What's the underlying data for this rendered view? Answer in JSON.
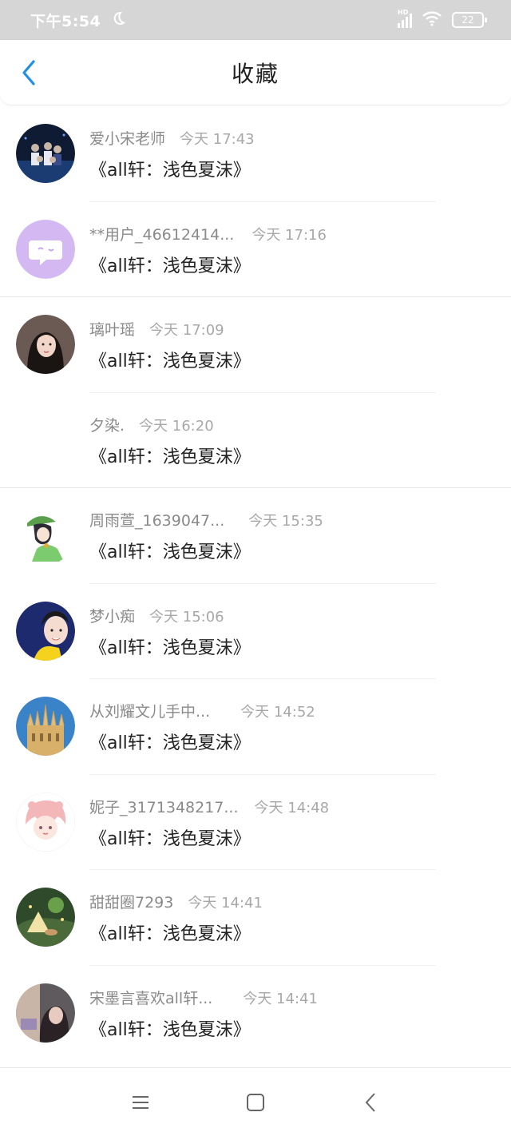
{
  "status_bar": {
    "time": "下午5:54",
    "battery": "22",
    "network": "HD"
  },
  "header": {
    "title": "收藏",
    "back_icon": "chevron-left-icon",
    "accent_color": "#1e90e6"
  },
  "items": [
    {
      "user": "爱小宋老师",
      "time": "今天 17:43",
      "title": "《all轩：浅色夏沫》",
      "avatar": "photo-group-concert"
    },
    {
      "user": "**用户_46612414...",
      "time": "今天 17:16",
      "title": "《all轩：浅色夏沫》",
      "avatar": "default-chat-bubble"
    },
    {
      "user": "璃叶瑶",
      "time": "今天 17:09",
      "title": "《all轩：浅色夏沫》",
      "avatar": "photo-portrait-girl"
    },
    {
      "user": "夕染.",
      "time": "今天 16:20",
      "title": "《all轩：浅色夏沫》",
      "avatar": "none"
    },
    {
      "user": "周雨萱_1639047...",
      "time": "今天 15:35",
      "title": "《all轩：浅色夏沫》",
      "avatar": "anime-green-hat"
    },
    {
      "user": "梦小痴",
      "time": "今天 15:06",
      "title": "《all轩：浅色夏沫》",
      "avatar": "photo-portrait-boy"
    },
    {
      "user": "从刘耀文儿手中...",
      "time": "今天 14:52",
      "title": "《all轩：浅色夏沫》",
      "avatar": "photo-cathedral"
    },
    {
      "user": "妮子_3171348217...",
      "time": "今天 14:48",
      "title": "《all轩：浅色夏沫》",
      "avatar": "anime-pink-hair"
    },
    {
      "user": "甜甜圈7293",
      "time": "今天 14:41",
      "title": "《all轩：浅色夏沫》",
      "avatar": "photo-tent-night"
    },
    {
      "user": "宋墨言喜欢all轩...",
      "time": "今天 14:41",
      "title": "《all轩：浅色夏沫》",
      "avatar": "photo-girl-desk"
    }
  ],
  "nav_bar": {
    "menu_icon": "menu-icon",
    "home_icon": "home-square-icon",
    "back_icon": "back-triangle-icon"
  }
}
